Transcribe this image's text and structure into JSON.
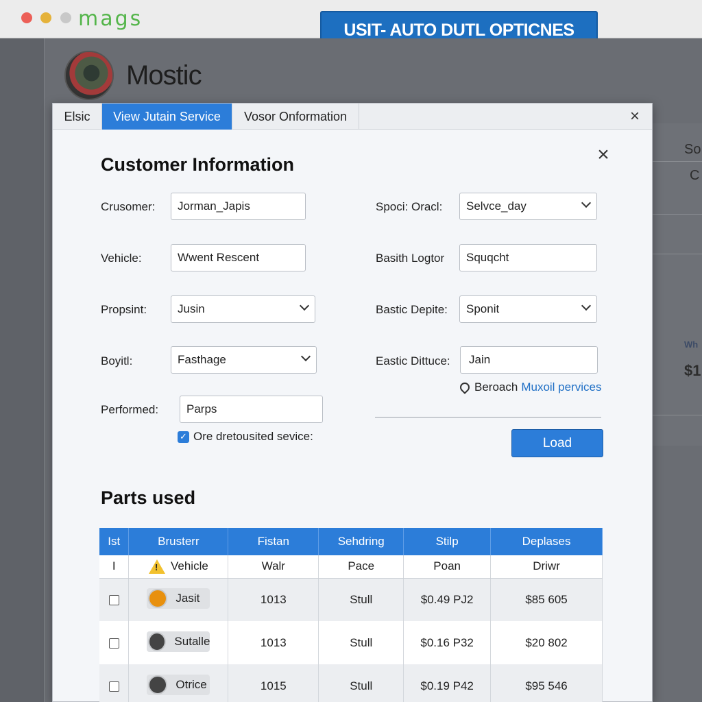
{
  "browser": {
    "brand": "mags"
  },
  "promo": {
    "text": "USIT- AUTO DUTL OPTICNES"
  },
  "background": {
    "profile_name": "Mostic",
    "right_col_1": "So",
    "right_col_2": "C",
    "right_col_3": "Wh",
    "right_col_4": "$1"
  },
  "dialog": {
    "tabs": [
      "Elsic",
      "View Jutain Service",
      "Vosor Onformation"
    ],
    "close_glyph": "×",
    "section_close_glyph": "×"
  },
  "customer": {
    "title": "Customer Information",
    "fields": {
      "customer": {
        "label": "Crusomer:",
        "value": "Jorman_Japis"
      },
      "vehicle": {
        "label": "Vehicle:",
        "value": "Wwent Rescent"
      },
      "propsint": {
        "label": "Propsint:",
        "value": "Jusin"
      },
      "boyitl": {
        "label": "Boyitl:",
        "value": "Fasthage"
      },
      "performed": {
        "label": "Performed:",
        "value": "Parps"
      },
      "spoci_oracl": {
        "label": "Spoci: Oracl:",
        "value": "Selvce_day"
      },
      "basith_logtor": {
        "label": "Basith Logtor",
        "value": "Squqcht"
      },
      "bastic_depite": {
        "label": "Bastic Depite:",
        "value": "Sponit"
      },
      "eastic_dittuce": {
        "label": "Eastic Dittuce:",
        "value": "Jain"
      }
    },
    "checkbox_label": "Ore dretousited sevice:",
    "checkbox_glyph": "✓",
    "location_label": "Beroach",
    "location_link": "Muxoil pervices",
    "load_button": "Load"
  },
  "parts": {
    "title": "Parts used",
    "columns": [
      "Ist",
      "Brusterr",
      "Fistan",
      "Sehdring",
      "Stilp",
      "Deplases"
    ],
    "subheader": [
      "I",
      "Vehicle",
      "Walr",
      "Pace",
      "Poan",
      "Driwr"
    ],
    "rows": [
      {
        "name": "Jasit",
        "status_color": "#e8900e",
        "c3": "1013",
        "c4": "Stull",
        "c5": "$0.49 PJ2",
        "c6": "$85 605"
      },
      {
        "name": "Sutalle",
        "status_color": "#444444",
        "c3": "1013",
        "c4": "Stull",
        "c5": "$0.16 P32",
        "c6": "$20 802"
      },
      {
        "name": "Otrice",
        "status_color": "#444444",
        "c3": "1015",
        "c4": "Stull",
        "c5": "$0.19 P42",
        "c6": "$95 546"
      }
    ]
  }
}
